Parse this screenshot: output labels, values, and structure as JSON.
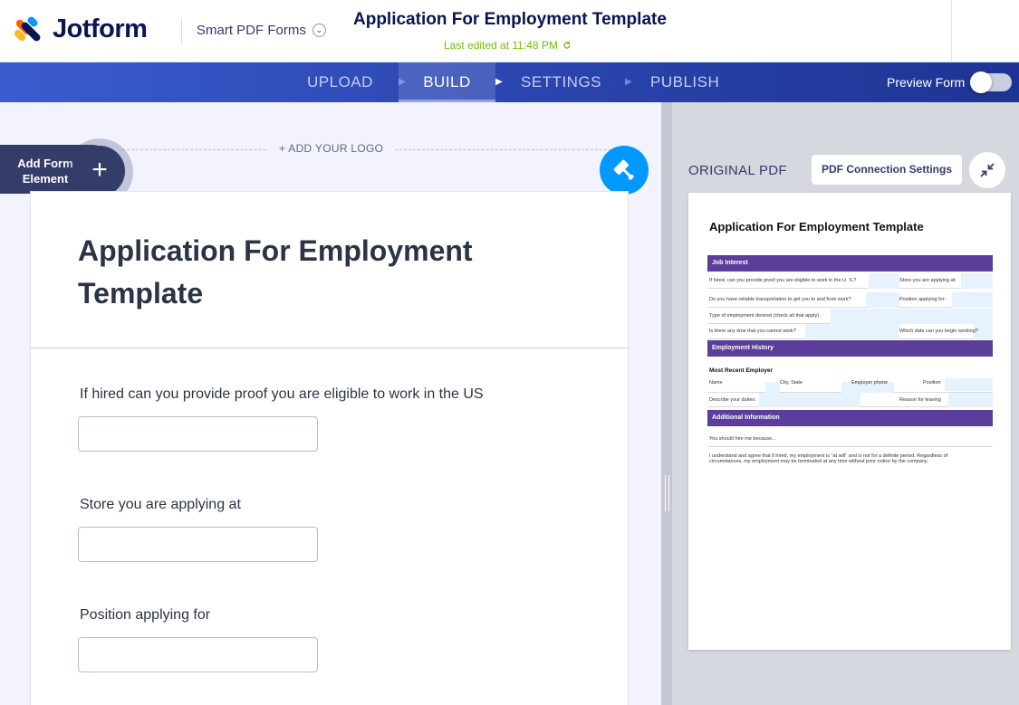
{
  "header": {
    "brand": "Jotform",
    "product": "Smart PDF Forms",
    "doc_title": "Application For Employment Template",
    "last_edited": "Last edited at 11:48 PM"
  },
  "nav": {
    "upload": "UPLOAD",
    "build": "BUILD",
    "settings": "SETTINGS",
    "publish": "PUBLISH",
    "preview_label": "Preview Form"
  },
  "builder": {
    "add_logo": "+ ADD YOUR LOGO",
    "add_element_label": "Add Form Element",
    "form_title": "Application For Employment Template",
    "questions": [
      {
        "label": "If hired can you provide proof you are eligible to work in the US"
      },
      {
        "label": "Store you are applying at"
      },
      {
        "label": "Position applying for"
      }
    ]
  },
  "pdf_panel": {
    "label": "ORIGINAL PDF",
    "connection_button": "PDF Connection Settings",
    "page": {
      "title": "Application For Employment Template",
      "band_job": "Job Interest",
      "band_history": "Employment History",
      "band_additional": "Additional Information",
      "rows": {
        "r1_left": "If hired, can you provide proof  you are eligible to work in the U. S.?",
        "r1_right": "Store you are applying at:",
        "r2_left": "Do you have reliable transportation to get you to and from work?",
        "r2_right": "Position applying for:",
        "r3_left": "Type of employment desired (check all that apply)",
        "r4_left": "Is there any time that you cannot work?",
        "r4_right": "Which date can you begin working?"
      },
      "recent_employer": "Most Recent Employer",
      "employer_fields": {
        "name": "Name",
        "city_state": "City, State",
        "phone": "Employer phone",
        "position": "Position",
        "duties": "Describe your duties:",
        "reason": "Reason for leaving"
      },
      "hire_me": "You should hire me because...",
      "agreement": "I understand and agree that if hired, my employment is \"at will\" and is not for a definite period.  Regardless of circumstances, my employment may be terminated at any time without prior notice by the company."
    }
  },
  "colors": {
    "brand_navy": "#0a1551",
    "nav_blue": "#2c48b2",
    "accent_blue": "#0099ff",
    "edited_green": "#78bb07",
    "pdf_band_purple": "#5a3e99"
  }
}
